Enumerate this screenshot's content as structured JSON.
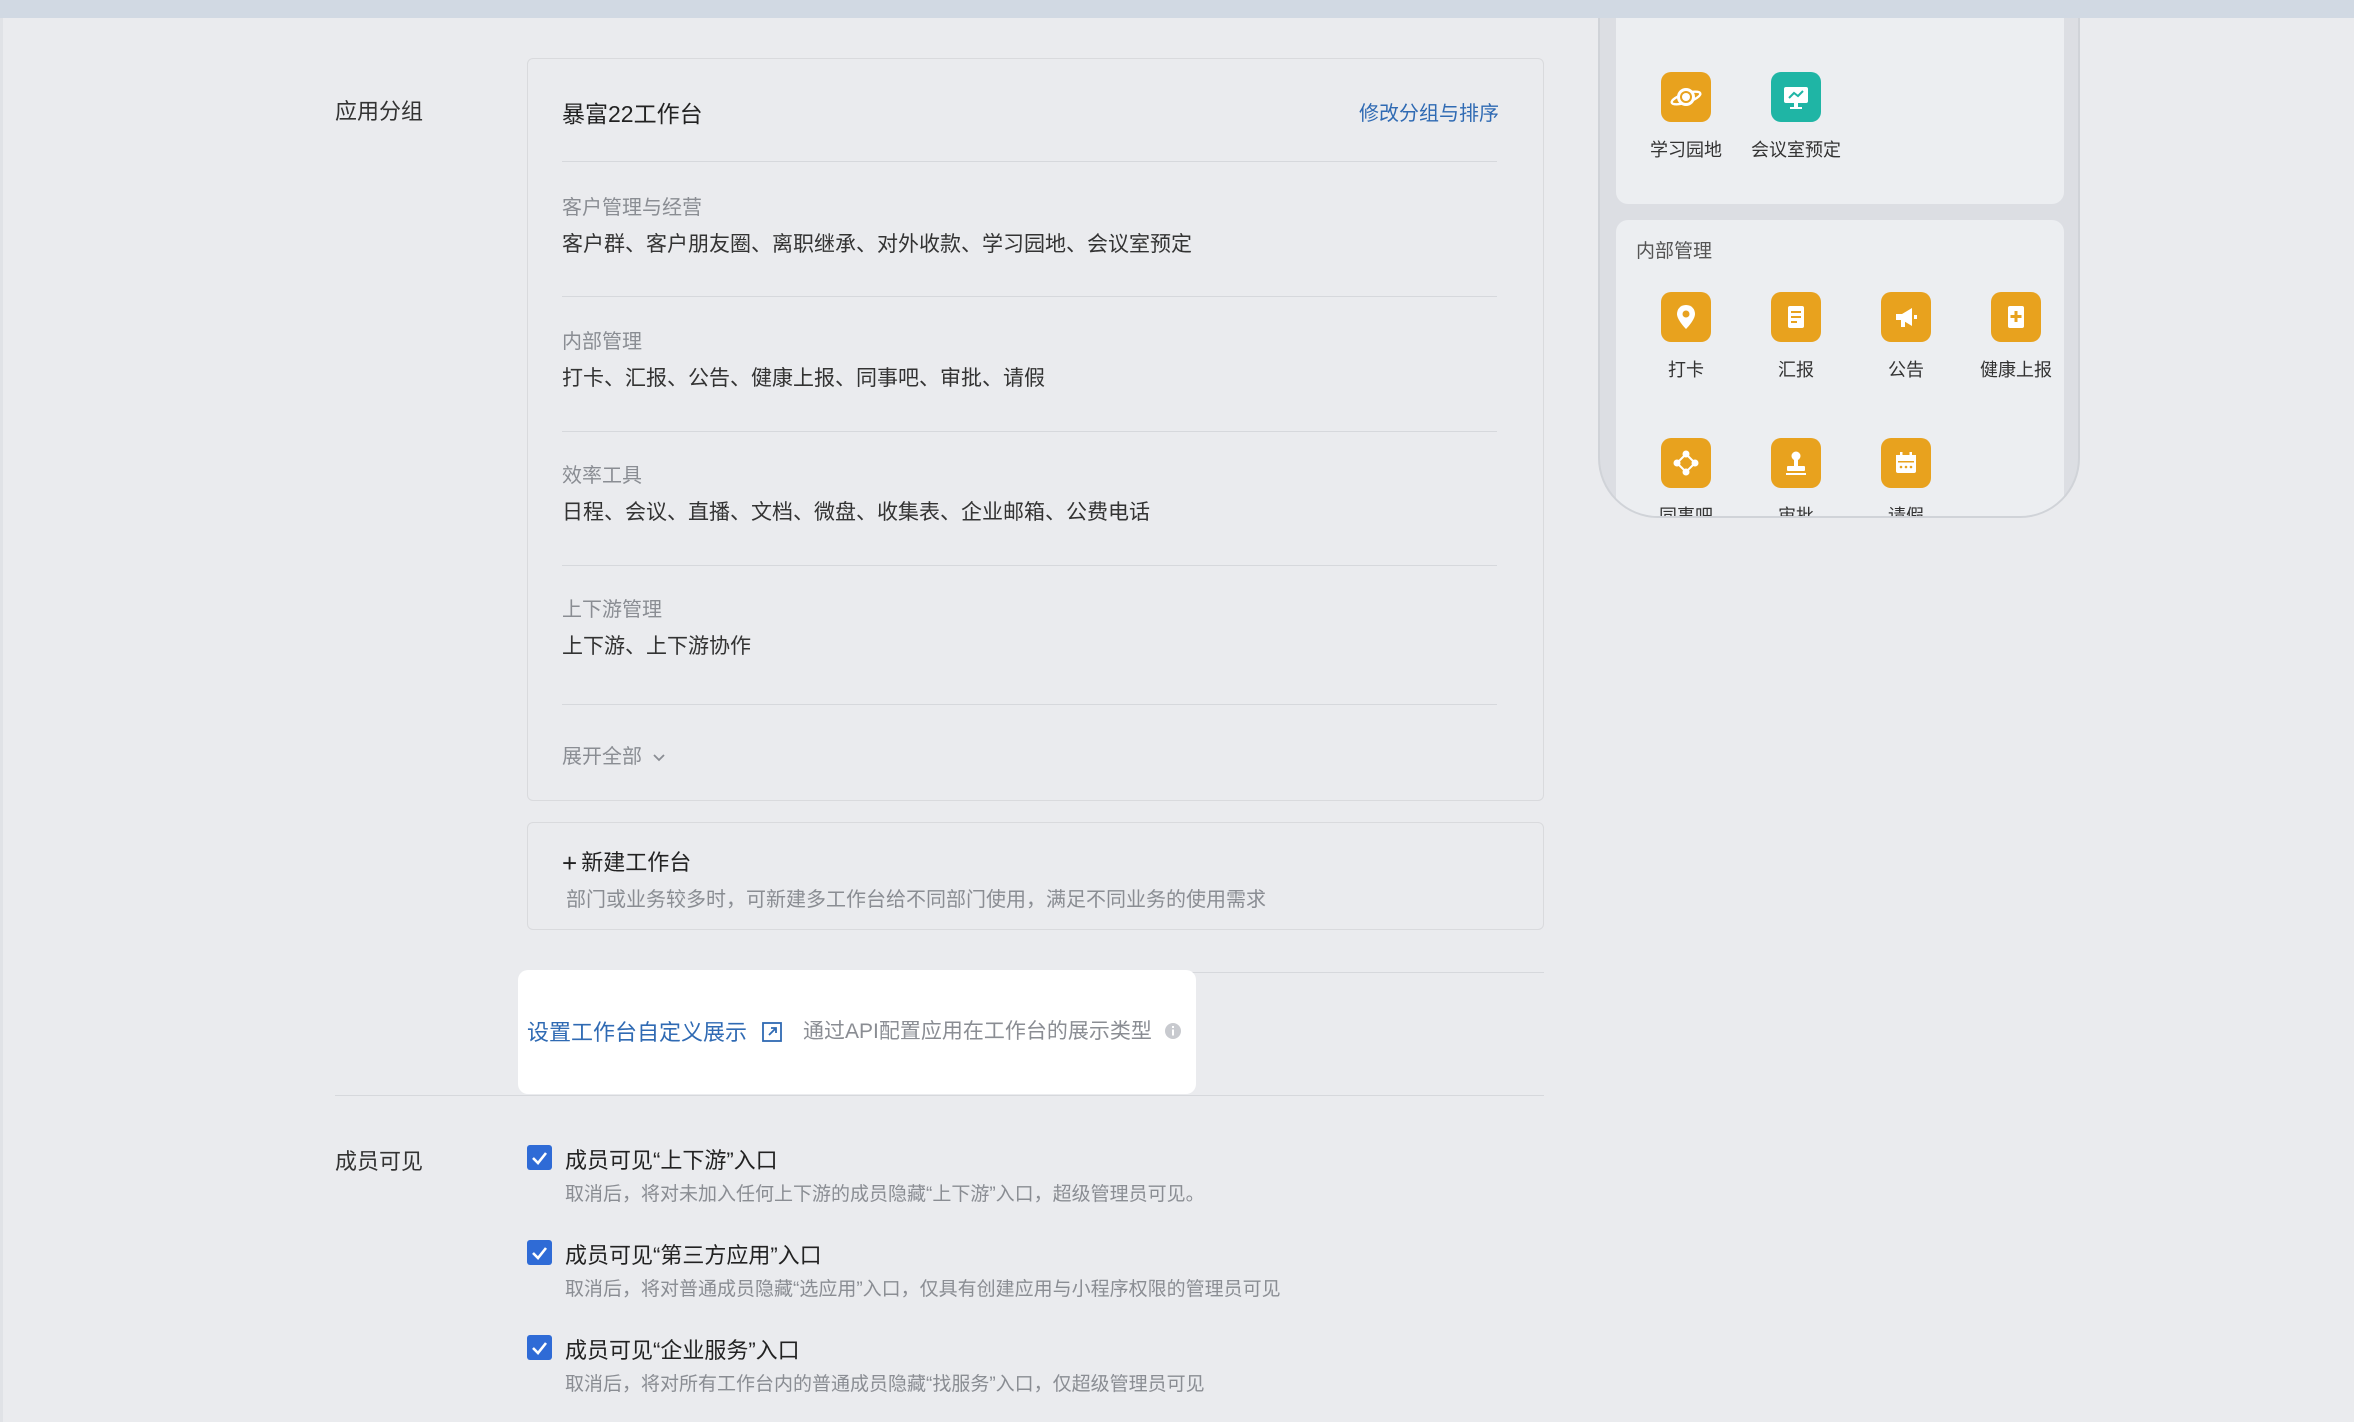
{
  "sections": {
    "app_groups_label": "应用分组",
    "member_visible_label": "成员可见"
  },
  "group_card": {
    "title": "暴富22工作台",
    "edit_link": "修改分组与排序",
    "groups": [
      {
        "name": "客户管理与经营",
        "apps": "客户群、客户朋友圈、离职继承、对外收款、学习园地、会议室预定"
      },
      {
        "name": "内部管理",
        "apps": "打卡、汇报、公告、健康上报、同事吧、审批、请假"
      },
      {
        "name": "效率工具",
        "apps": "日程、会议、直播、文档、微盘、收集表、企业邮箱、公费电话"
      },
      {
        "name": "上下游管理",
        "apps": "上下游、上下游协作"
      }
    ],
    "expand_all": "展开全部"
  },
  "new_workbench": {
    "title": "新建工作台",
    "plus": "+",
    "desc": "部门或业务较多时，可新建多工作台给不同部门使用，满足不同业务的使用需求"
  },
  "custom_display": {
    "link": "设置工作台自定义展示",
    "desc": "通过API配置应用在工作台的展示类型"
  },
  "member_options": [
    {
      "title": "成员可见“上下游”入口",
      "desc": "取消后，将对未加入任何上下游的成员隐藏“上下游”入口，超级管理员可见。",
      "checked": true
    },
    {
      "title": "成员可见“第三方应用”入口",
      "desc": "取消后，将对普通成员隐藏“选应用”入口，仅具有创建应用与小程序权限的管理员可见",
      "checked": true
    },
    {
      "title": "成员可见“企业服务”入口",
      "desc": "取消后，将对所有工作台内的普通成员隐藏“找服务”入口，仅超级管理员可见",
      "checked": true
    }
  ],
  "phone_preview": {
    "top_apps": [
      {
        "label": "学习园地",
        "icon": "planet-icon",
        "color": "#e8a21e"
      },
      {
        "label": "会议室预定",
        "icon": "monitor-icon",
        "color": "#1fb5a5"
      }
    ],
    "internal_title": "内部管理",
    "internal_apps": [
      {
        "label": "打卡",
        "icon": "location-pin-icon",
        "color": "#e8a21e"
      },
      {
        "label": "汇报",
        "icon": "report-icon",
        "color": "#e8a21e"
      },
      {
        "label": "公告",
        "icon": "megaphone-icon",
        "color": "#e8a21e"
      },
      {
        "label": "健康上报",
        "icon": "health-plus-icon",
        "color": "#e8a21e"
      },
      {
        "label": "同事吧",
        "icon": "share-icon",
        "color": "#e8a21e"
      },
      {
        "label": "审批",
        "icon": "stamp-icon",
        "color": "#e8a21e"
      },
      {
        "label": "请假",
        "icon": "calendar-icon",
        "color": "#e8a21e"
      }
    ]
  }
}
